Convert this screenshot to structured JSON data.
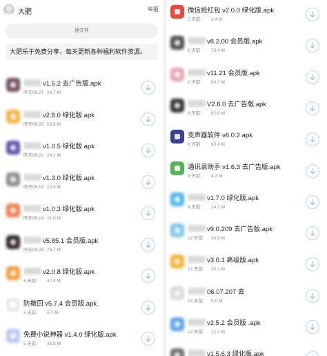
{
  "header": {
    "username": "大肥",
    "report_label": "举报"
  },
  "search": {
    "placeholder": "搜文件"
  },
  "announcement": "大肥乐于免费分享，每天更新各种福利软件资源。",
  "left_files": [
    {
      "name": "v1.5.2 去广告版.apk",
      "blurred_prefix": true,
      "time": "昨天09:27",
      "size": "24.7 M",
      "icon_color": "#6b4b5c",
      "icon_blur": true
    },
    {
      "name": "v2.8.0 绿化版.apk",
      "blurred_prefix": true,
      "time": "昨天09:25",
      "size": "53.8 M",
      "icon_color": "#f2b243",
      "icon_blur": true
    },
    {
      "name": "v1.0.5 绿化版.apk",
      "blurred_prefix": true,
      "time": "昨天09:22",
      "size": "24.1 M",
      "icon_color": "#5a4fa8",
      "icon_blur": true
    },
    {
      "name": "v1.3.0 绿化版.apk",
      "blurred_prefix": true,
      "time": "昨天09:15",
      "size": "22.0 M",
      "icon_color": "#8a8a8a",
      "icon_blur": true
    },
    {
      "name": "v1.0.3 绿化版.apk",
      "blurred_prefix": true,
      "time": "昨天09:14",
      "size": "21.9 M",
      "icon_color": "#f07a4a",
      "icon_blur": true
    },
    {
      "name": "v5.85.1 会员版.apk",
      "blurred_prefix": true,
      "time": "昨天09:09",
      "size": "76.7 M",
      "icon_color": "#2e2226",
      "icon_blur": true
    },
    {
      "name": "v2.0.8 绿化版.apk",
      "blurred_prefix": true,
      "time": "4 天前",
      "size": "47.4 M",
      "icon_color": "#f29a3c",
      "icon_blur": true
    },
    {
      "name": "防撤回 v5.7.4 会员版.apk",
      "blurred_prefix": false,
      "time": "4 天前",
      "size": "5.7 M",
      "icon_color": "#e9eef8",
      "icon_blur": false
    },
    {
      "name": "免费小说神器 v1.4.0 绿化版.apk",
      "blurred_prefix": false,
      "time": "5 天前",
      "size": "35.9 M",
      "icon_color": "#b7c6ee",
      "icon_blur": true
    }
  ],
  "right_files": [
    {
      "name": "微信抢红包 v2.0.0 绿化版.apk",
      "blurred_prefix": false,
      "time": "5 天前",
      "size": "3.4 M",
      "icon_color": "#e84a3c",
      "icon_blur": false
    },
    {
      "name": "v8.2.00 会员版.apk",
      "blurred_prefix": true,
      "time": "6 天前",
      "size": "73.4 M",
      "icon_color": "#4b4b4b",
      "icon_blur": true
    },
    {
      "name": "v11.21 会员版.apk",
      "blurred_prefix": true,
      "time": "6 天前",
      "size": "83.7 M",
      "icon_color": "#e7a3b0",
      "icon_blur": true
    },
    {
      "name": "V2.6.0 去广告版.apk",
      "blurred_prefix": true,
      "time": "6 天前",
      "size": "62.0 M",
      "icon_color": "#2f2f2f",
      "icon_blur": true
    },
    {
      "name": "变声器软件 v6.0.2.apk",
      "blurred_prefix": false,
      "time": "6 天前",
      "size": "63.4 M",
      "icon_color": "#3a3f8f",
      "icon_blur": false
    },
    {
      "name": "通讯录助手 v1.6.3 去广告版.apk",
      "blurred_prefix": false,
      "time": "8 天前",
      "size": "4.2 M",
      "icon_color": "#58b35a",
      "icon_blur": false
    },
    {
      "name": "v1.7.0 绿化版.apk",
      "blurred_prefix": true,
      "time": "8 天前",
      "size": "14.1 M",
      "icon_color": "#4bb6e6",
      "icon_blur": true
    },
    {
      "name": "v9.0.209 去广告版.apk",
      "blurred_prefix": true,
      "time": "12 天前",
      "size": "30.8 M",
      "icon_color": "#7ec4ea",
      "icon_blur": true
    },
    {
      "name": "v3.0.1 高级版.apk",
      "blurred_prefix": true,
      "time": "12 天前",
      "size": "30.1 M",
      "icon_color": "#f2b233",
      "icon_blur": true
    },
    {
      "name": "06.07.207 去",
      "blurred_prefix": true,
      "time": "12 天前",
      "size": "9.0 M",
      "icon_color": "#d9d9d9",
      "icon_blur": true
    },
    {
      "name": "v2.5.2 会员版 .apk",
      "blurred_prefix": true,
      "time": "12 天前",
      "size": "12.1 M",
      "icon_color": "#5aa0e6",
      "icon_blur": true
    },
    {
      "name": "v1.5.6.3 绿化版.apk",
      "blurred_prefix": true,
      "time": "",
      "size": "",
      "icon_color": "#6b6b6b",
      "icon_blur": true
    }
  ],
  "colors": {
    "download_circle": "#bcd4ea",
    "download_arrow": "#8fb3d6",
    "divider": "#f2f2f2"
  },
  "icons": {
    "download": "download-arrow-icon",
    "avatar": "user-avatar-icon"
  }
}
